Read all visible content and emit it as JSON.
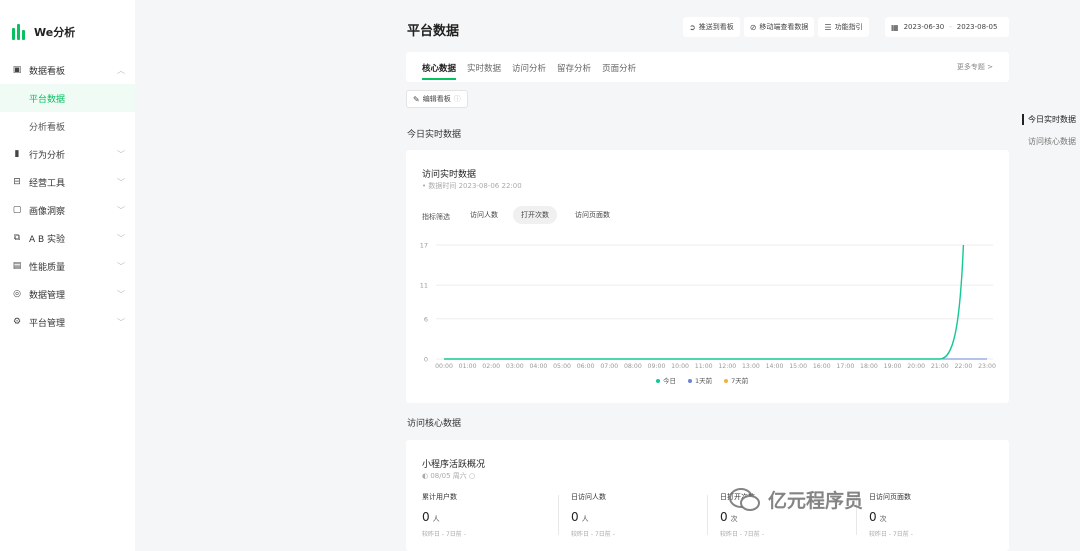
{
  "app": {
    "name": "We分析"
  },
  "sidebar": {
    "items": [
      {
        "icon": "dashboard-icon",
        "label": "数据看板",
        "expanded": true,
        "children": [
          {
            "label": "平台数据",
            "active": true
          },
          {
            "label": "分析看板",
            "active": false
          }
        ]
      },
      {
        "icon": "bar-chart-icon",
        "label": "行为分析"
      },
      {
        "icon": "tools-icon",
        "label": "经营工具"
      },
      {
        "icon": "portrait-icon",
        "label": "画像洞察"
      },
      {
        "icon": "ab-test-icon",
        "label": "A B 实验"
      },
      {
        "icon": "monitor-icon",
        "label": "性能质量"
      },
      {
        "icon": "shield-icon",
        "label": "数据管理"
      },
      {
        "icon": "gear-icon",
        "label": "平台管理"
      }
    ]
  },
  "header": {
    "title": "平台数据",
    "actions": [
      {
        "icon": "send-icon",
        "label": "推送到看板"
      },
      {
        "icon": "mobile-icon",
        "label": "移动端查看数据"
      },
      {
        "icon": "guide-icon",
        "label": "功能指引"
      }
    ],
    "date_start": "2023-06-30",
    "date_sep": "-",
    "date_end": "2023-08-05"
  },
  "tabs": {
    "items": [
      "核心数据",
      "实时数据",
      "访问分析",
      "留存分析",
      "页面分析"
    ],
    "active": 0,
    "more": "更多专题 >"
  },
  "edit_board": {
    "label": "编辑看板"
  },
  "section_realtime": {
    "title": "今日实时数据"
  },
  "realtime_card": {
    "title": "访问实时数据",
    "subtitle": "• 数据时间 2023-08-06 22:00",
    "filter_label": "指标筛选",
    "filters": [
      {
        "label": "访问人数",
        "active": false
      },
      {
        "label": "打开次数",
        "active": true
      },
      {
        "label": "访问页面数",
        "active": false
      }
    ]
  },
  "chart_data": {
    "type": "line",
    "x": [
      "00:00",
      "01:00",
      "02:00",
      "03:00",
      "04:00",
      "05:00",
      "06:00",
      "07:00",
      "08:00",
      "09:00",
      "10:00",
      "11:00",
      "12:00",
      "13:00",
      "14:00",
      "15:00",
      "16:00",
      "17:00",
      "18:00",
      "19:00",
      "20:00",
      "21:00",
      "22:00",
      "23:00"
    ],
    "y_ticks": [
      0,
      6,
      11,
      17
    ],
    "ylim": [
      0,
      17
    ],
    "series": [
      {
        "name": "今日",
        "color": "#15c795",
        "values": [
          0,
          0,
          0,
          0,
          0,
          0,
          0,
          0,
          0,
          0,
          0,
          0,
          0,
          0,
          0,
          0,
          0,
          0,
          0,
          0,
          0,
          0,
          17
        ]
      },
      {
        "name": "1天前",
        "color": "#6b84d8",
        "values": [
          0,
          0,
          0,
          0,
          0,
          0,
          0,
          0,
          0,
          0,
          0,
          0,
          0,
          0,
          0,
          0,
          0,
          0,
          0,
          0,
          0,
          0,
          0,
          0
        ]
      },
      {
        "name": "7天前",
        "color": "#f4b33b",
        "values": [
          0,
          0,
          0,
          0,
          0,
          0,
          0,
          0,
          0,
          0,
          0,
          0,
          0,
          0,
          0,
          0,
          0,
          0,
          0,
          0,
          0,
          0,
          0,
          0
        ]
      }
    ],
    "grid": true,
    "legend": "bottom-center"
  },
  "section_core": {
    "title": "访问核心数据"
  },
  "core_card": {
    "title": "小程序活跃概况",
    "subtitle": "08/05 周六",
    "metrics": [
      {
        "label": "累计用户数",
        "value": "0",
        "unit": "人",
        "compare": "较昨日 -   7日前 -"
      },
      {
        "label": "日访问人数",
        "value": "0",
        "unit": "人",
        "compare": "较昨日 -   7日前 -"
      },
      {
        "label": "日打开次数",
        "value": "0",
        "unit": "次",
        "compare": "较昨日 -   7日前 -"
      },
      {
        "label": "日访问页面数",
        "value": "0",
        "unit": "次",
        "compare": "较昨日 -   7日前 -"
      }
    ]
  },
  "anchors": [
    {
      "label": "今日实时数据",
      "active": true
    },
    {
      "label": "访问核心数据",
      "active": false
    }
  ],
  "watermark": {
    "text": "亿元程序员"
  }
}
